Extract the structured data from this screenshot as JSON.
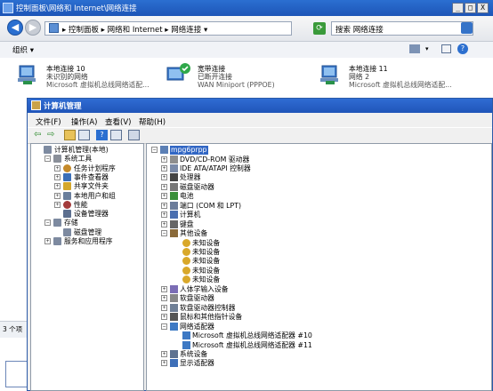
{
  "network_window": {
    "title": "控制面板\\网络和 Internet\\网络连接",
    "window_buttons": [
      "_",
      "□",
      "X"
    ],
    "address": "▸ 控制面板 ▸ 网络和 Internet ▸ 网络连接 ▾",
    "search_placeholder": "搜索 网络连接",
    "organize_label": "组织 ▾",
    "status_count": "3 个项",
    "connections": [
      {
        "name": "本地连接 10",
        "status": "未识别的网络",
        "device": "Microsoft 虚拟机总线网络适配..."
      },
      {
        "name": "宽带连接",
        "status": "已断开连接",
        "device": "WAN Miniport (PPPOE)"
      },
      {
        "name": "本地连接 11",
        "status": "网络 2",
        "device": "Microsoft 虚拟机总线网络适配..."
      }
    ]
  },
  "computer_management": {
    "title": "计算机管理",
    "menu": [
      "文件(F)",
      "操作(A)",
      "查看(V)",
      "帮助(H)"
    ],
    "left_tree": [
      {
        "label": "计算机管理(本地)",
        "level": 0
      },
      {
        "label": "系统工具",
        "level": 1
      },
      {
        "label": "任务计划程序",
        "level": 2
      },
      {
        "label": "事件查看器",
        "level": 2
      },
      {
        "label": "共享文件夹",
        "level": 2
      },
      {
        "label": "本地用户和组",
        "level": 2
      },
      {
        "label": "性能",
        "level": 2
      },
      {
        "label": "设备管理器",
        "level": 2
      },
      {
        "label": "存储",
        "level": 1
      },
      {
        "label": "磁盘管理",
        "level": 2
      },
      {
        "label": "服务和应用程序",
        "level": 1
      }
    ],
    "device_root": "mpg6prpp",
    "devices": [
      {
        "label": "DVD/CD-ROM 驱动器",
        "level": 1
      },
      {
        "label": "IDE ATA/ATAPI 控制器",
        "level": 1
      },
      {
        "label": "处理器",
        "level": 1
      },
      {
        "label": "磁盘驱动器",
        "level": 1
      },
      {
        "label": "电池",
        "level": 1
      },
      {
        "label": "端口 (COM 和 LPT)",
        "level": 1
      },
      {
        "label": "计算机",
        "level": 1
      },
      {
        "label": "键盘",
        "level": 1
      },
      {
        "label": "其他设备",
        "level": 1
      },
      {
        "label": "未知设备",
        "level": 2
      },
      {
        "label": "未知设备",
        "level": 2
      },
      {
        "label": "未知设备",
        "level": 2
      },
      {
        "label": "未知设备",
        "level": 2
      },
      {
        "label": "未知设备",
        "level": 2
      },
      {
        "label": "人体学输入设备",
        "level": 1
      },
      {
        "label": "软盘驱动器",
        "level": 1
      },
      {
        "label": "软盘驱动器控制器",
        "level": 1
      },
      {
        "label": "鼠标和其他指针设备",
        "level": 1
      },
      {
        "label": "网络适配器",
        "level": 1
      },
      {
        "label": "Microsoft 虚拟机总线网络适配器 #10",
        "level": 2
      },
      {
        "label": "Microsoft 虚拟机总线网络适配器 #11",
        "level": 2
      },
      {
        "label": "系统设备",
        "level": 1
      },
      {
        "label": "显示适配器",
        "level": 1
      }
    ]
  }
}
